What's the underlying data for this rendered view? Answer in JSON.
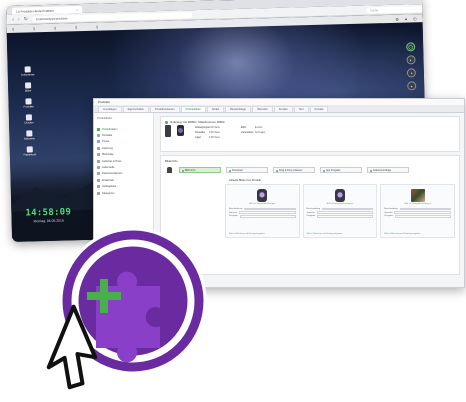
{
  "browser": {
    "tab_title": "LX Produkte Heute Erstellen",
    "url": "localhost/apps/produkte",
    "search_placeholder": "Suche"
  },
  "desktop": {
    "icons": [
      "Dokumente",
      "Bilder",
      "Produkte",
      "Drucker",
      "Netzwerk",
      "Papierkorb"
    ],
    "clock": "14:58:09",
    "date": "Montag, 06.05.2016"
  },
  "app": {
    "title": "Produkte",
    "tabs": [
      "Grundlagen",
      "Eigenschaften",
      "Produktvarianten",
      "Produktbilder",
      "Artikel",
      "Bestandslage",
      "Übersicht",
      "Kunden",
      "Text",
      "Kontakt"
    ],
    "active_tab_index": 3,
    "sidebar_logo": "Produktfinder",
    "sidebar": [
      "Produktdaten",
      "Kontakte",
      "Preise",
      "Lieferung",
      "Merkmale",
      "Lieferbar & Preis",
      "Lieferstelle",
      "Dokumentationen",
      "Ersatzteile",
      "Auftragsliste",
      "Kategorien"
    ],
    "sidebar_active_index": 0,
    "product_title": "IK-Energy AG 36999 / Artikelnummer 28990",
    "kv": [
      {
        "k": "Artikelgruppe",
        "v": "3.00 Serie"
      },
      {
        "k": "Hersteller",
        "v": "3.00 Serie"
      },
      {
        "k": "Lager",
        "v": "3.00 Serie"
      },
      {
        "k": "EAN",
        "v": "E-Auto"
      },
      {
        "k": "Lieferstatus",
        "v": "Auf Lager"
      }
    ],
    "section_title": "Bilder/Info",
    "buttons": [
      "Bild hinzu",
      "Download",
      "Drag & Drop zulassen",
      "App Freigabe",
      "Artikelvorschläge"
    ],
    "gallery_title": "Aktuelle Bilder zum Produkt",
    "card_caption": "Bild als Hauptbild festlegen",
    "fields": [
      "Beschreibung",
      "Sprache",
      "Freigabe"
    ],
    "card_footer": "Bild in Webshop und Katalog freigeben"
  },
  "colors": {
    "accent_green": "#4caf50",
    "clock_green": "#48e07a",
    "badge_purple": "#7a2fb0",
    "badge_ring": "#9b4fd0",
    "plus_green": "#48b04a"
  },
  "icons": {
    "badge": "puzzle-icon",
    "cursor": "arrow-cursor-icon"
  }
}
